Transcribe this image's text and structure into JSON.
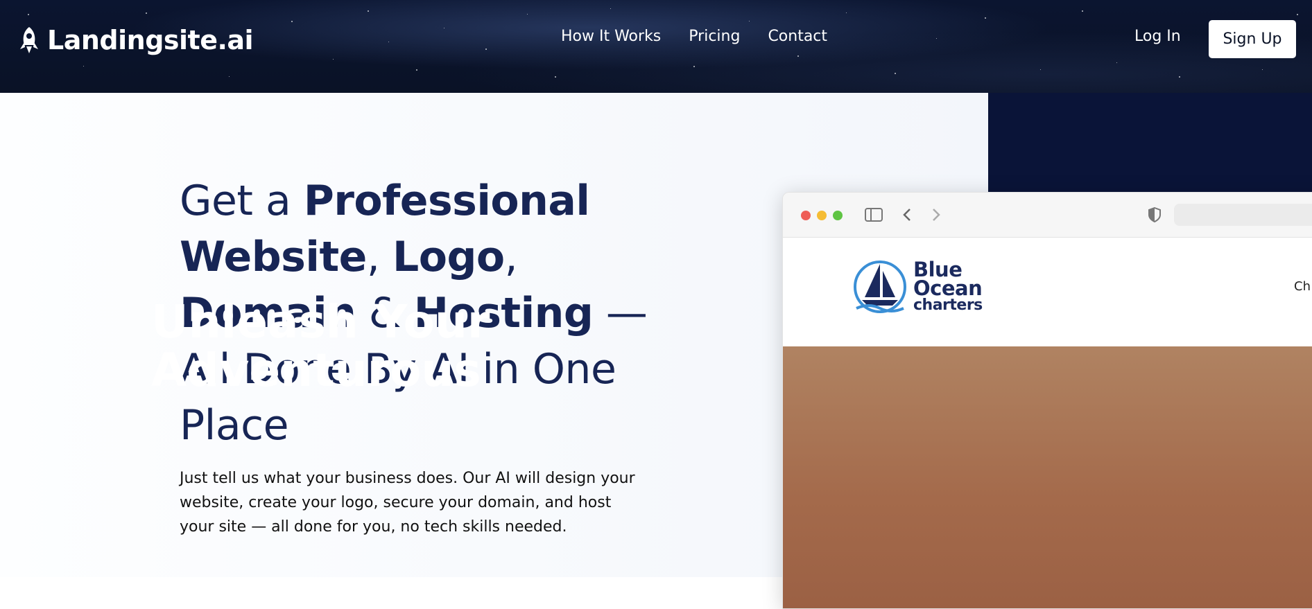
{
  "brand": {
    "name": "Landingsite.ai"
  },
  "nav": {
    "items": [
      "How It Works",
      "Pricing",
      "Contact"
    ]
  },
  "auth": {
    "login": "Log In",
    "signup": "Sign Up"
  },
  "hero": {
    "headline": {
      "part1": "Get a ",
      "part2": "Professional Website",
      "part3": ", ",
      "part4": "Logo",
      "part5": ",",
      "part6": "Domain",
      "part7": " & ",
      "part8": "Hosting",
      "part9": " —",
      "part10": "All Done By AI in One Place"
    },
    "subtext": "Just tell us what your business does. Our AI will design your website, create your logo, secure your domain, and host your site — all done for you, no tech skills needed."
  },
  "mockup": {
    "logo_line1": "Blue",
    "logo_line2": "Ocean",
    "logo_line3": "charters",
    "nav_cut": "Ch",
    "hero_line1": "Unleash Your",
    "hero_line2": "Adventurous"
  },
  "colors": {
    "navy": "#172555",
    "dark_block": "#0a1438",
    "accent_brown": "#a46a4b"
  }
}
